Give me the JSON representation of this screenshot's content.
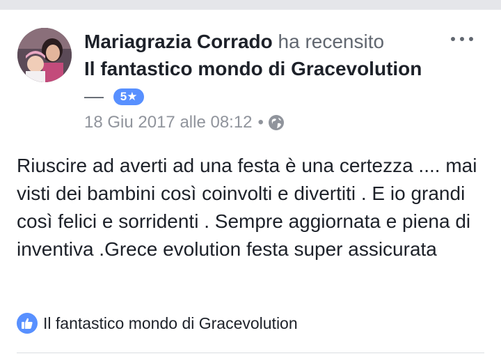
{
  "review": {
    "author": "Mariagrazia Corrado",
    "action": "ha recensito",
    "page_name": "Il fantastico mondo di Gracevolution",
    "dash": "—",
    "rating_badge": "5★",
    "timestamp": "18 Giu 2017 alle 08:12",
    "separator": "•",
    "privacy_icon": "globe-icon",
    "more_icon": "more-options-icon",
    "body": "Riuscire ad averti ad una festa è una certezza .... mai visti dei bambini così coinvolti e divertiti . E io grandi così felici e sorridenti . Sempre aggiornata e piena di inventiva .Grece evolution festa super assicurata",
    "liked_by": "Il fantastico mondo di Gracevolution",
    "liked_icon": "thumbs-up-icon"
  },
  "colors": {
    "badge": "#5890ff",
    "text": "#1d2129",
    "meta": "#90949c",
    "divider": "#dadde1"
  }
}
